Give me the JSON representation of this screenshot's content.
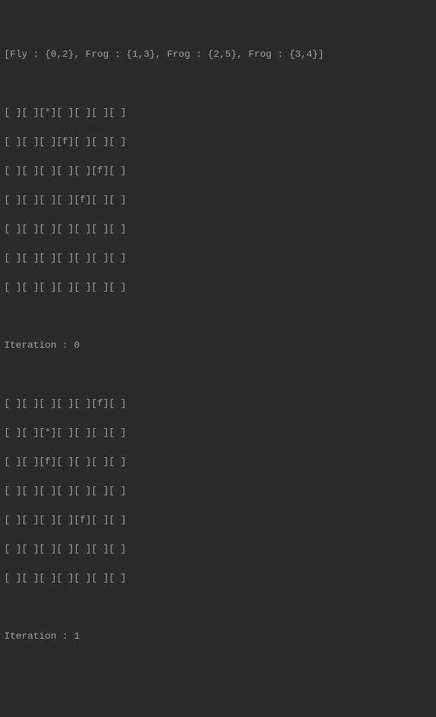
{
  "header": "[Fly : {0,2}, Frog : {1,3}, Frog : {2,5}, Frog : {3,4}]",
  "iterations": [
    {
      "label": "Iteration : 0",
      "grid": [
        "[ ][ ][*][ ][ ][ ][ ]",
        "[ ][ ][ ][f][ ][ ][ ]",
        "[ ][ ][ ][ ][ ][f][ ]",
        "[ ][ ][ ][ ][f][ ][ ]",
        "[ ][ ][ ][ ][ ][ ][ ]",
        "[ ][ ][ ][ ][ ][ ][ ]",
        "[ ][ ][ ][ ][ ][ ][ ]"
      ]
    },
    {
      "label": "Iteration : 1",
      "grid": [
        "[ ][ ][ ][ ][ ][f][ ]",
        "[ ][ ][*][ ][ ][ ][ ]",
        "[ ][ ][f][ ][ ][ ][ ]",
        "[ ][ ][ ][ ][ ][ ][ ]",
        "[ ][ ][ ][ ][f][ ][ ]",
        "[ ][ ][ ][ ][ ][ ][ ]",
        "[ ][ ][ ][ ][ ][ ][ ]"
      ]
    }
  ]
}
